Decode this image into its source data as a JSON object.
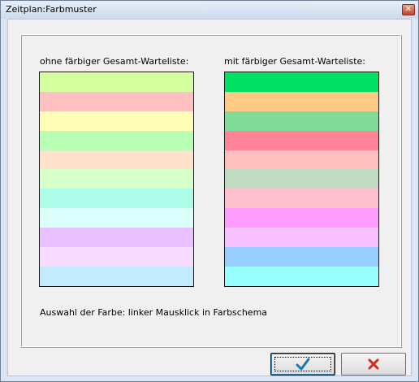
{
  "window": {
    "title": "Zeitplan:Farbmuster",
    "close_icon": "close-icon"
  },
  "left_panel": {
    "label": "ohne färbiger Gesamt-Warteliste:",
    "colors": [
      "#d5ff9f",
      "#ffc1bf",
      "#fffdb6",
      "#b9feb5",
      "#ffe2cb",
      "#d6ffca",
      "#aefde9",
      "#dbfff9",
      "#e9c2ff",
      "#f8dbfe",
      "#c2ebfd"
    ]
  },
  "right_panel": {
    "label": "mit färbiger Gesamt-Warteliste:",
    "colors": [
      "#00e064",
      "#ffcb84",
      "#81dc9a",
      "#ff8499",
      "#ffbfbd",
      "#bfdbc2",
      "#ffc1ce",
      "#ff9dfe",
      "#f5c1ff",
      "#98ceff",
      "#99fffc"
    ]
  },
  "hint": "Auswahl der Farbe: linker Mausklick in Farbschema",
  "buttons": {
    "ok_icon": "checkmark-icon",
    "cancel_icon": "x-icon"
  }
}
